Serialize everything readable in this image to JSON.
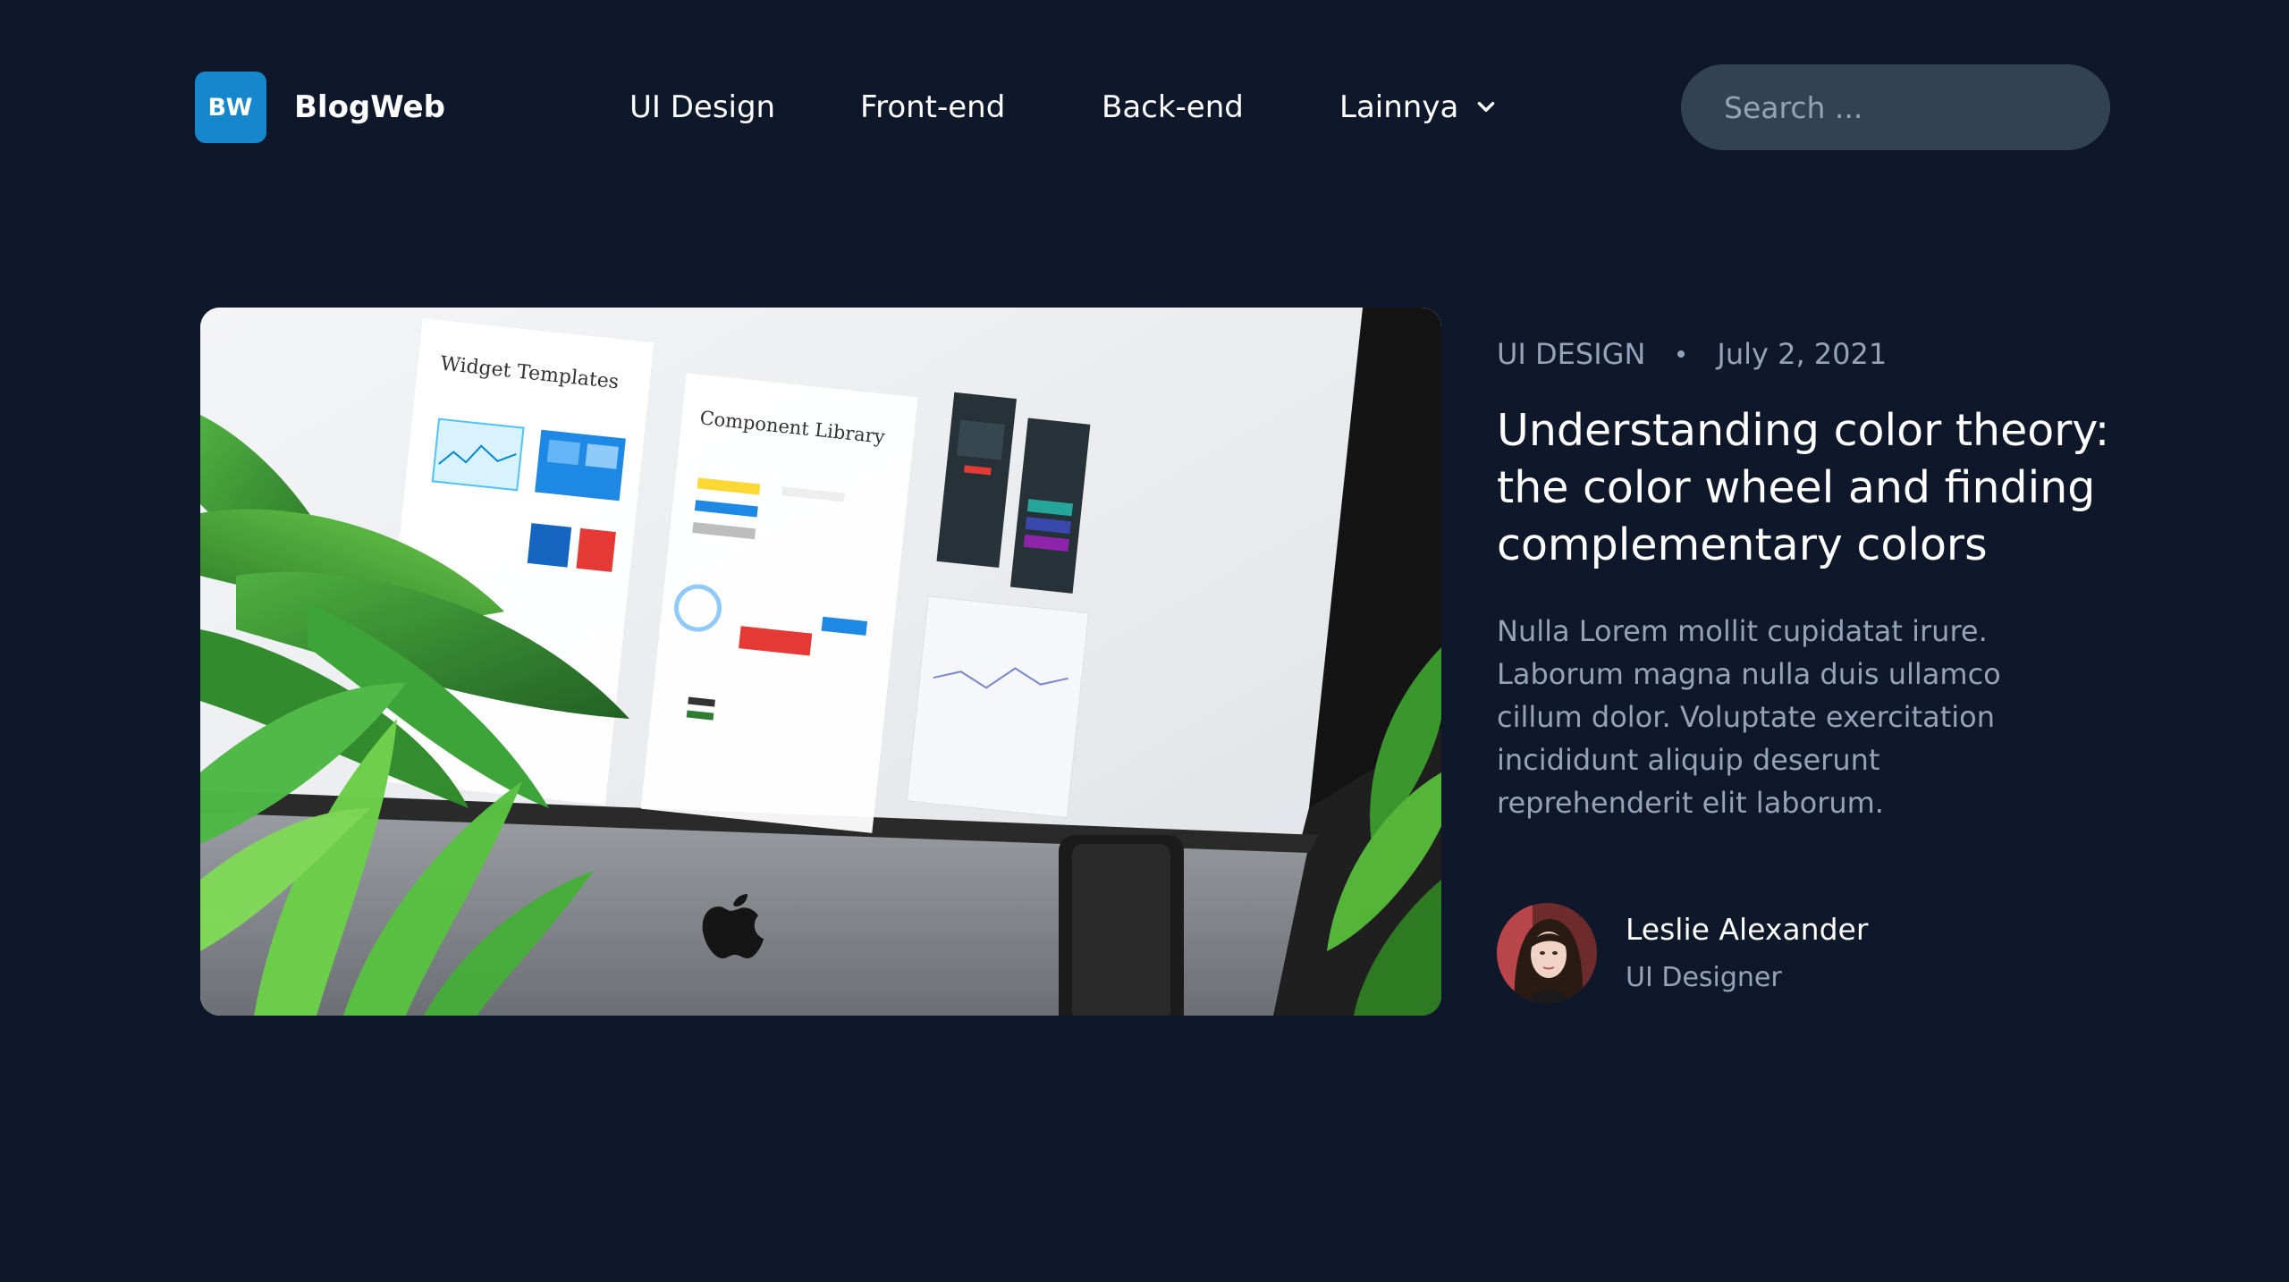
{
  "brand": {
    "badge": "BW",
    "name": "BlogWeb",
    "accent": "#1787cd"
  },
  "nav": {
    "items": [
      {
        "label": "UI Design"
      },
      {
        "label": "Front-end"
      },
      {
        "label": "Back-end"
      },
      {
        "label": "Lainnya",
        "icon": "chevron-down-icon"
      }
    ]
  },
  "search": {
    "placeholder": "Search ...",
    "value": ""
  },
  "post": {
    "category": "UI DESIGN",
    "date": "July 2, 2021",
    "title": "Understanding color theory: the color wheel and finding complementary colors",
    "excerpt": "Nulla Lorem mollit cupidatat irure. Laborum magna nulla duis ullamco cillum dolor. Voluptate exercitation incididunt aliquip deserunt reprehenderit elit laborum.",
    "image": {
      "card_1_title": "Widget Templates",
      "card_2_title": "Component Library"
    },
    "author": {
      "name": "Leslie Alexander",
      "role": "UI Designer"
    }
  },
  "colors": {
    "background": "#0f172a",
    "search_bg": "#334155",
    "muted_text": "#94a3b8"
  }
}
